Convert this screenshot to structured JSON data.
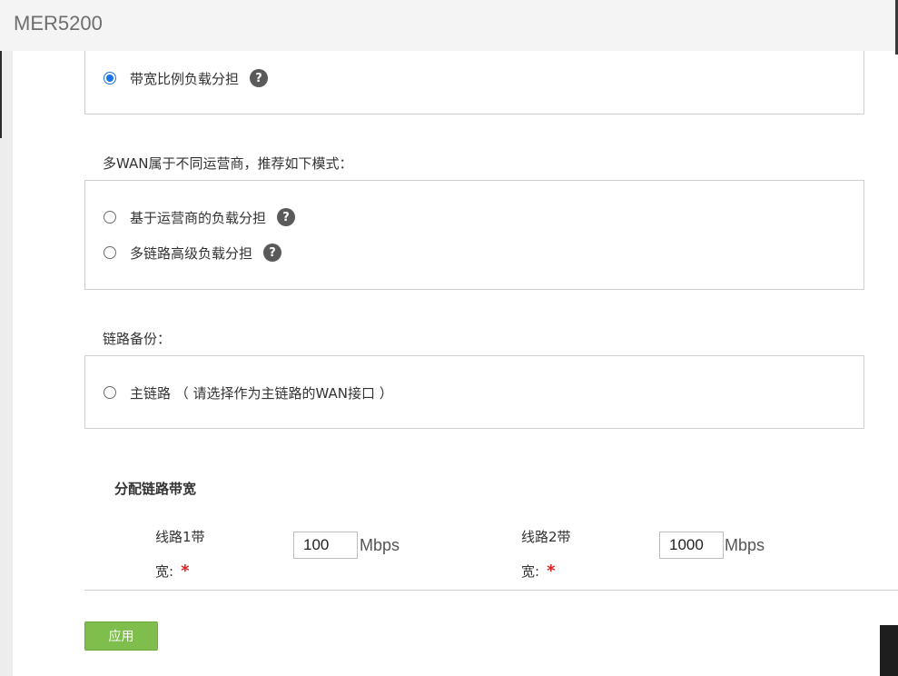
{
  "app": {
    "title": "MER5200"
  },
  "load_balance": {
    "bandwidth_ratio": {
      "label": "带宽比例负载分担",
      "selected": true
    }
  },
  "multi_isp": {
    "label": "多WAN属于不同运营商，推荐如下模式：",
    "options": [
      {
        "label": "基于运营商的负载分担",
        "selected": false
      },
      {
        "label": "多链路高级负载分担",
        "selected": false
      }
    ]
  },
  "backup": {
    "label": "链路备份：",
    "primary": {
      "label": "主链路 （ 请选择作为主链路的WAN接口 ）",
      "selected": false
    }
  },
  "bandwidth": {
    "title": "分配链路带宽",
    "lines": [
      {
        "label_line1": "线路1带",
        "label_line2": "宽:",
        "required_mark": "*",
        "value": "100",
        "unit": "Mbps"
      },
      {
        "label_line1": "线路2带",
        "label_line2": "宽:",
        "required_mark": "*",
        "value": "1000",
        "unit": "Mbps"
      }
    ]
  },
  "apply_label": "应用",
  "help_glyph": "?"
}
